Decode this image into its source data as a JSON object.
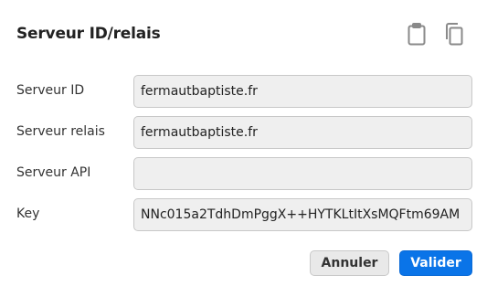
{
  "dialog": {
    "title": "Serveur ID/relais"
  },
  "header_icons": [
    {
      "name": "clipboard-icon",
      "action": "paste"
    },
    {
      "name": "copy-icon",
      "action": "copy"
    }
  ],
  "fields": [
    {
      "label": "Serveur ID",
      "value": "fermautbaptiste.fr",
      "placeholder": ""
    },
    {
      "label": "Serveur relais",
      "value": "fermautbaptiste.fr",
      "placeholder": ""
    },
    {
      "label": "Serveur API",
      "value": "",
      "placeholder": ""
    },
    {
      "label": "Key",
      "value": "NNc015a2TdhDmPggX++HYTKLtItXsMQFtm69AM",
      "placeholder": ""
    }
  ],
  "buttons": {
    "cancel_label": "Annuler",
    "ok_label": "Valider"
  },
  "colors": {
    "primary": "#0a74e8",
    "input_bg": "#efefef",
    "icon": "#8a8a8a"
  }
}
